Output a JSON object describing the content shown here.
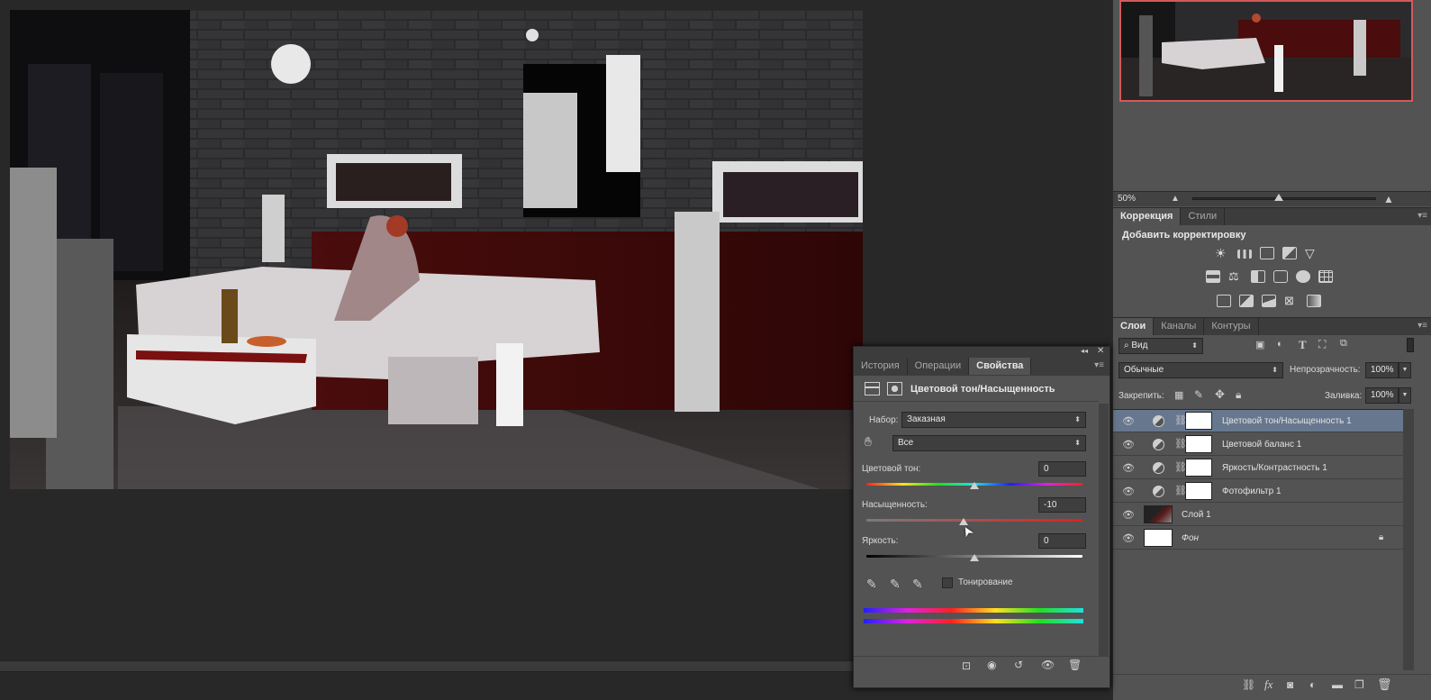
{
  "navigator": {
    "zoom": "50%",
    "zoom_fraction": 0.5
  },
  "adjustments": {
    "tabs": [
      "Коррекция",
      "Стили"
    ],
    "add_label": "Добавить корректировку",
    "row1_icons": [
      "brightness-icon",
      "levels-icon",
      "curves-icon",
      "exposure-icon",
      "vibrance-icon"
    ],
    "row2_icons": [
      "hue-saturation-icon",
      "color-balance-icon",
      "black-white-icon",
      "photo-filter-icon",
      "channel-mixer-icon",
      "color-lookup-icon"
    ],
    "row3_icons": [
      "invert-icon",
      "posterize-icon",
      "threshold-icon",
      "selective-color-icon",
      "gradient-map-icon"
    ]
  },
  "layers_panel": {
    "tabs": [
      "Слои",
      "Каналы",
      "Контуры"
    ],
    "filter_label": "Вид",
    "blend_mode": "Обычные",
    "opacity_label": "Непрозрачность:",
    "opacity_value": "100%",
    "lock_label": "Закрепить:",
    "fill_label": "Заливка:",
    "fill_value": "100%",
    "layers": [
      {
        "name": "Цветовой тон/Насыщенность 1",
        "type": "adjustment",
        "selected": true
      },
      {
        "name": "Цветовой баланс 1",
        "type": "adjustment",
        "selected": false
      },
      {
        "name": "Яркость/Контрастность 1",
        "type": "adjustment",
        "selected": false
      },
      {
        "name": "Фотофильтр 1",
        "type": "adjustment",
        "selected": false
      },
      {
        "name": "Слой 1",
        "type": "image",
        "selected": false
      },
      {
        "name": "Фон",
        "type": "background",
        "selected": false,
        "locked": true
      }
    ]
  },
  "properties": {
    "tabs": [
      "История",
      "Операции",
      "Свойства"
    ],
    "active_tab": "Свойства",
    "title": "Цветовой тон/Насыщенность",
    "preset_label": "Набор:",
    "preset_value": "Заказная",
    "channel_value": "Все",
    "hue_label": "Цветовой тон:",
    "hue_value": "0",
    "hue_num": 0,
    "saturation_label": "Насыщенность:",
    "saturation_value": "-10",
    "saturation_num": -10,
    "lightness_label": "Яркость:",
    "lightness_value": "0",
    "lightness_num": 0,
    "colorize_label": "Тонирование",
    "colorize_checked": false
  },
  "colors": {
    "selected_layer": "#67778e",
    "nav_frame": "#d25a5a",
    "panel_bg": "#535353"
  }
}
